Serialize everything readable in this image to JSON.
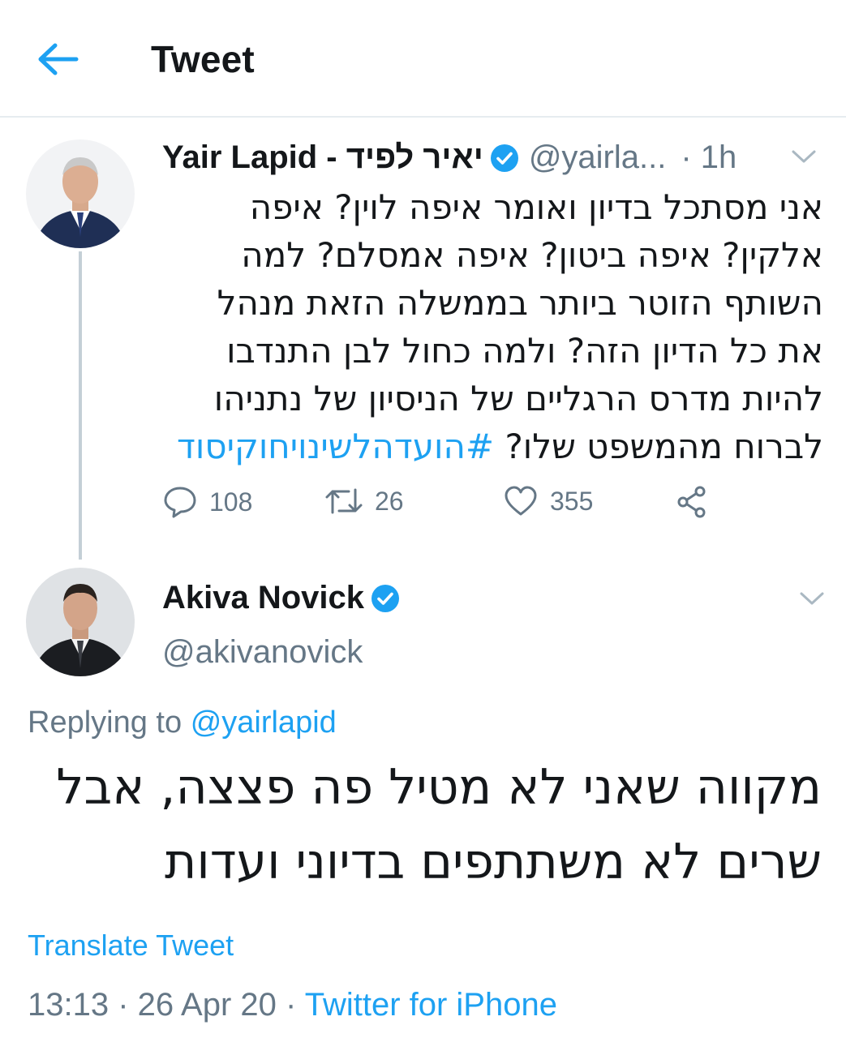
{
  "header": {
    "title": "Tweet",
    "back_icon": "arrow-left-icon"
  },
  "colors": {
    "accent": "#1da1f2",
    "secondary_text": "#657786",
    "primary_text": "#14171a",
    "divider": "#e6ecf0"
  },
  "parent_tweet": {
    "display_name": "Yair Lapid - יאיר לפיד",
    "handle": "@yairla...",
    "time": "· 1h",
    "verified": true,
    "text_lines": [
      "אני מסתכל בדיון ואומר איפה לוין? איפה",
      "אלקין? איפה ביטון? איפה אמסלם? למה",
      "השותף הזוטר ביותר בממשלה הזאת מנהל",
      "את כל הדיון הזה? ולמה כחול לבן התנדבו",
      "להיות מדרס הרגליים של הניסיון של נתניהו",
      "לברוח מהמשפט שלו?"
    ],
    "hashtag": "#הועדהלשינויחוקיסוד",
    "actions": {
      "replies": "108",
      "retweets": "26",
      "likes": "355"
    }
  },
  "reply_tweet": {
    "display_name": "Akiva Novick",
    "handle": "@akivanovick",
    "verified": true,
    "replying_to_prefix": "Replying to",
    "replying_to_handle": "@yairlapid",
    "text_lines": [
      "מקווה שאני לא מטיל פה פצצה, אבל",
      "שרים לא משתתפים בדיוני ועדות"
    ],
    "translate_label": "Translate Tweet",
    "timestamp": "13:13 · 26 Apr 20 ·",
    "source": "Twitter for iPhone"
  }
}
